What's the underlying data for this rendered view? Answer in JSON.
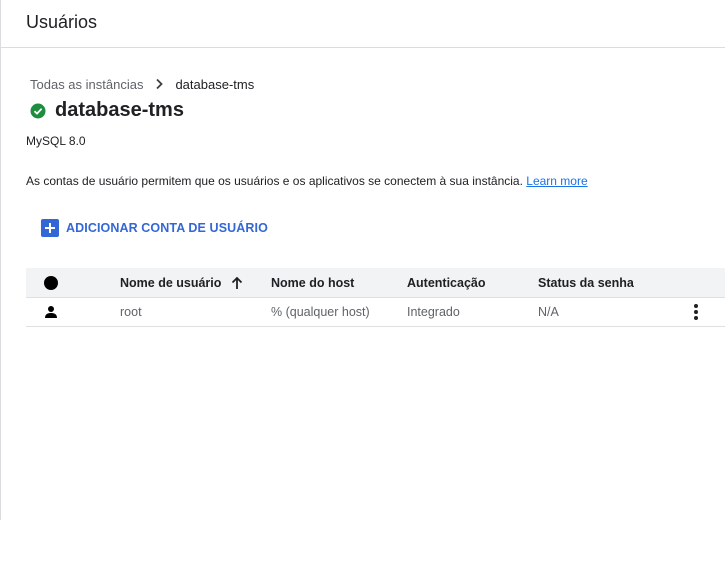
{
  "header": {
    "title": "Usuários"
  },
  "breadcrumb": {
    "parent": "Todas as instâncias",
    "current": "database-tms"
  },
  "instance": {
    "name": "database-tms",
    "status_icon": "check-circle-icon",
    "status_color": "#1e8e3e",
    "version": "MySQL 8.0"
  },
  "description": {
    "text": "As contas de usuário permitem que os usuários e os aplicativos se conectem à sua instância.",
    "link": "Learn more"
  },
  "actions": {
    "add_user_label": "ADICIONAR CONTA DE USUÁRIO",
    "accent": "#3367d6"
  },
  "table": {
    "columns": {
      "username": "Nome de usuário",
      "host": "Nome do host",
      "auth": "Autenticação",
      "password_status": "Status da senha"
    },
    "sort": {
      "column": "username",
      "direction": "ascending"
    },
    "rows": [
      {
        "icon": "person-icon",
        "username": "root",
        "host": "% (qualquer host)",
        "auth": "Integrado",
        "password_status": "N/A"
      }
    ]
  }
}
